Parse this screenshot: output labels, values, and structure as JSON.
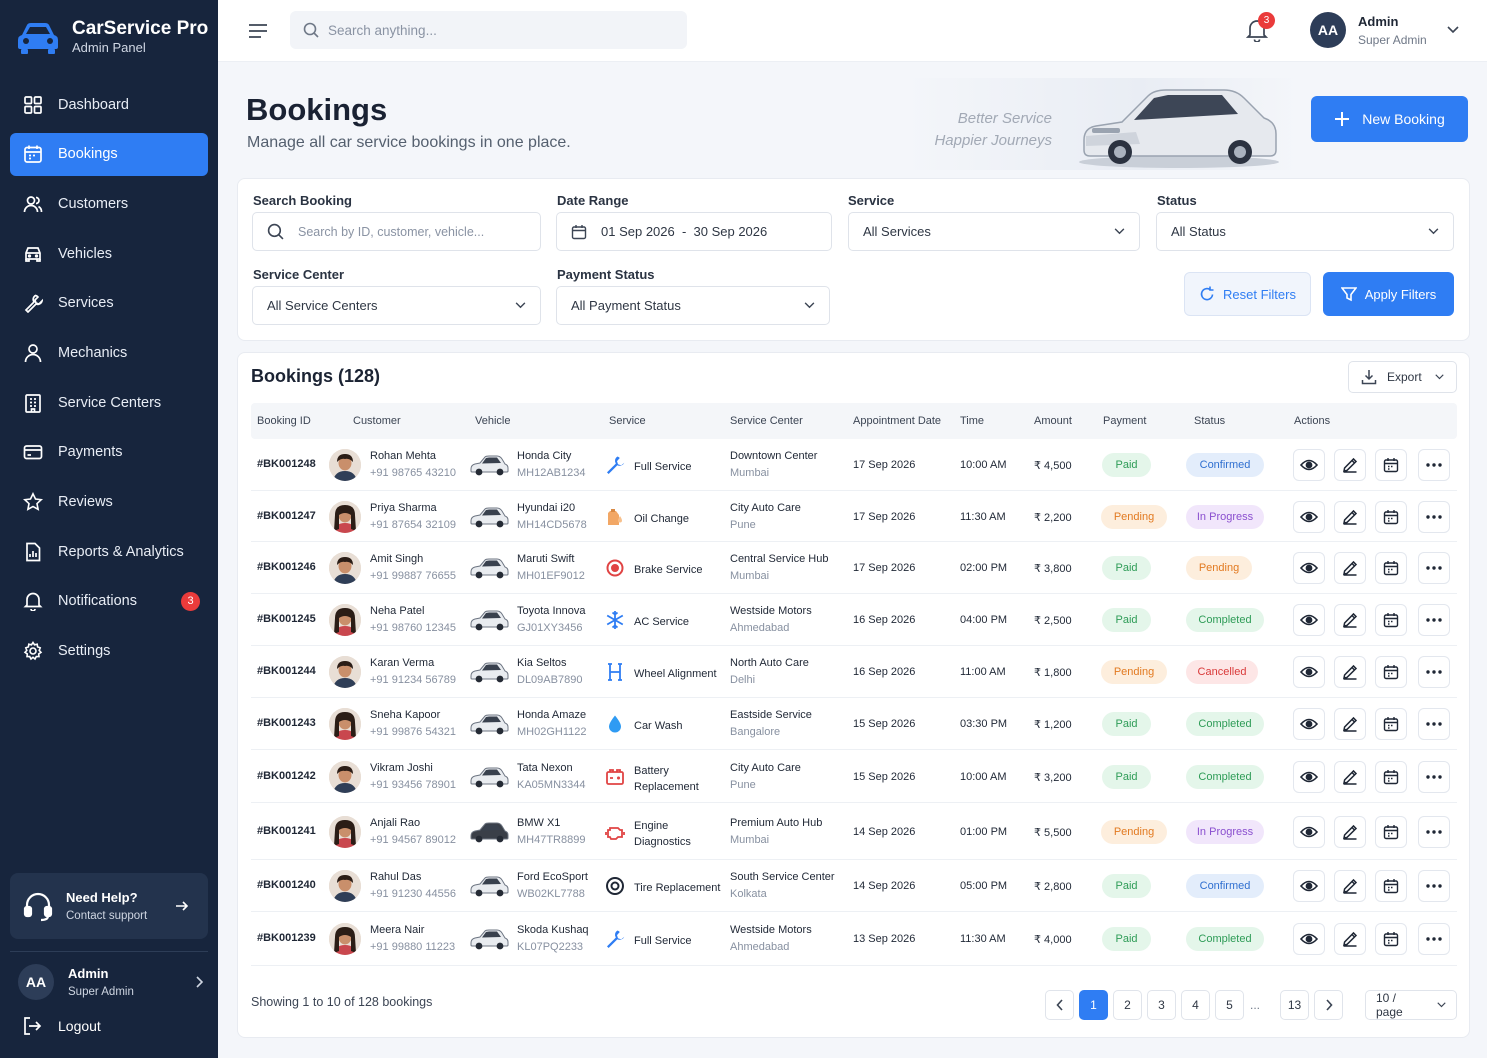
{
  "app": {
    "title": "CarService Pro",
    "subtitle": "Admin Panel"
  },
  "sidebar": {
    "items": [
      {
        "label": "Dashboard",
        "icon": "grid-icon"
      },
      {
        "label": "Bookings",
        "icon": "calendar-icon",
        "active": true
      },
      {
        "label": "Customers",
        "icon": "users-icon"
      },
      {
        "label": "Vehicles",
        "icon": "car-icon"
      },
      {
        "label": "Services",
        "icon": "wrench-icon"
      },
      {
        "label": "Mechanics",
        "icon": "user-icon"
      },
      {
        "label": "Service Centers",
        "icon": "building-icon"
      },
      {
        "label": "Payments",
        "icon": "card-icon"
      },
      {
        "label": "Reviews",
        "icon": "star-icon"
      },
      {
        "label": "Reports & Analytics",
        "icon": "report-icon"
      },
      {
        "label": "Notifications",
        "icon": "bell-icon",
        "badge": "3"
      },
      {
        "label": "Settings",
        "icon": "gear-icon"
      }
    ],
    "help": {
      "title": "Need Help?",
      "subtitle": "Contact support"
    },
    "user": {
      "initials": "AA",
      "name": "Admin",
      "role": "Super Admin"
    },
    "logout": "Logout"
  },
  "topbar": {
    "search_placeholder": "Search anything...",
    "notification_count": "3",
    "user": {
      "initials": "AA",
      "name": "Admin",
      "role": "Super Admin"
    }
  },
  "header": {
    "title": "Bookings",
    "subtitle": "Manage all car service bookings in one place.",
    "tagline_1": "Better Service",
    "tagline_2": "Happier Journeys",
    "new_booking": "New Booking"
  },
  "filters": {
    "search_label": "Search Booking",
    "search_placeholder": "Search by ID, customer, vehicle...",
    "date_label": "Date Range",
    "date_value": "01 Sep 2026  -  30 Sep 2026",
    "service_label": "Service",
    "service_value": "All Services",
    "status_label": "Status",
    "status_value": "All Status",
    "center_label": "Service Center",
    "center_value": "All Service Centers",
    "payment_label": "Payment Status",
    "payment_value": "All Payment Status",
    "reset": "Reset Filters",
    "apply": "Apply Filters"
  },
  "bookings": {
    "title": "Bookings (128)",
    "export": "Export",
    "columns": [
      "Booking ID",
      "Customer",
      "Vehicle",
      "Service",
      "Service Center",
      "Appointment Date",
      "Time",
      "Amount",
      "Payment",
      "Status",
      "Actions"
    ],
    "rows": [
      {
        "id": "#BK001248",
        "name": "Rohan Mehta",
        "phone": "+91 98765 43210",
        "gender": "m",
        "car": "Honda City",
        "plate": "MH12AB1234",
        "car_color": "#e9ecf0",
        "service": "Full Service",
        "svc_icon": "wrench-icon",
        "center": "Downtown Center",
        "city": "Mumbai",
        "date": "17 Sep 2026",
        "time": "10:00 AM",
        "amount": "₹ 4,500",
        "payment": "Paid",
        "status": "Confirmed"
      },
      {
        "id": "#BK001247",
        "name": "Priya Sharma",
        "phone": "+91 87654 32109",
        "gender": "f",
        "car": "Hyundai i20",
        "plate": "MH14CD5678",
        "car_color": "#e9ecf0",
        "service": "Oil Change",
        "svc_icon": "oil-icon",
        "center": "City Auto Care",
        "city": "Pune",
        "date": "17 Sep 2026",
        "time": "11:30 AM",
        "amount": "₹ 2,200",
        "payment": "Pending",
        "status": "In Progress"
      },
      {
        "id": "#BK001246",
        "name": "Amit Singh",
        "phone": "+91 99887 76655",
        "gender": "m",
        "car": "Maruti Swift",
        "plate": "MH01EF9012",
        "car_color": "#e9ecf0",
        "service": "Brake Service",
        "svc_icon": "brake-icon",
        "center": "Central Service Hub",
        "city": "Mumbai",
        "date": "17 Sep 2026",
        "time": "02:00 PM",
        "amount": "₹ 3,800",
        "payment": "Paid",
        "status": "Pending"
      },
      {
        "id": "#BK001245",
        "name": "Neha Patel",
        "phone": "+91 98760 12345",
        "gender": "f",
        "car": "Toyota Innova",
        "plate": "GJ01XY3456",
        "car_color": "#e9ecf0",
        "service": "AC Service",
        "svc_icon": "snowflake-icon",
        "center": "Westside Motors",
        "city": "Ahmedabad",
        "date": "16 Sep 2026",
        "time": "04:00 PM",
        "amount": "₹ 2,500",
        "payment": "Paid",
        "status": "Completed"
      },
      {
        "id": "#BK001244",
        "name": "Karan Verma",
        "phone": "+91 91234 56789",
        "gender": "m",
        "car": "Kia Seltos",
        "plate": "DL09AB7890",
        "car_color": "#e9ecf0",
        "service": "Wheel Alignment",
        "svc_icon": "alignment-icon",
        "center": "North Auto Care",
        "city": "Delhi",
        "date": "16 Sep 2026",
        "time": "11:00 AM",
        "amount": "₹ 1,800",
        "payment": "Pending",
        "status": "Cancelled"
      },
      {
        "id": "#BK001243",
        "name": "Sneha Kapoor",
        "phone": "+91 99876 54321",
        "gender": "f",
        "car": "Honda Amaze",
        "plate": "MH02GH1122",
        "car_color": "#e9ecf0",
        "service": "Car Wash",
        "svc_icon": "droplet-icon",
        "center": "Eastside Service",
        "city": "Bangalore",
        "date": "15 Sep 2026",
        "time": "03:30 PM",
        "amount": "₹ 1,200",
        "payment": "Paid",
        "status": "Completed"
      },
      {
        "id": "#BK001242",
        "name": "Vikram Joshi",
        "phone": "+91 93456 78901",
        "gender": "m",
        "car": "Tata Nexon",
        "plate": "KA05MN3344",
        "car_color": "#e9ecf0",
        "service": "Battery\nReplacement",
        "svc_icon": "battery-icon",
        "center": "City Auto Care",
        "city": "Pune",
        "date": "15 Sep 2026",
        "time": "10:00 AM",
        "amount": "₹ 3,200",
        "payment": "Paid",
        "status": "Completed"
      },
      {
        "id": "#BK001241",
        "name": "Anjali Rao",
        "phone": "+91 94567 89012",
        "gender": "f",
        "car": "BMW X1",
        "plate": "MH47TR8899",
        "car_color": "#3a3f48",
        "service": "Engine\nDiagnostics",
        "svc_icon": "engine-icon",
        "center": "Premium Auto Hub",
        "city": "Mumbai",
        "date": "14 Sep 2026",
        "time": "01:00 PM",
        "amount": "₹ 5,500",
        "payment": "Pending",
        "status": "In Progress"
      },
      {
        "id": "#BK001240",
        "name": "Rahul Das",
        "phone": "+91 91230 44556",
        "gender": "m",
        "car": "Ford EcoSport",
        "plate": "WB02KL7788",
        "car_color": "#e9ecf0",
        "service": "Tire Replacement",
        "svc_icon": "tire-icon",
        "center": "South Service Center",
        "city": "Kolkata",
        "date": "14 Sep 2026",
        "time": "05:00 PM",
        "amount": "₹ 2,800",
        "payment": "Paid",
        "status": "Confirmed"
      },
      {
        "id": "#BK001239",
        "name": "Meera Nair",
        "phone": "+91 99880 11223",
        "gender": "f",
        "car": "Skoda Kushaq",
        "plate": "KL07PQ2233",
        "car_color": "#e9ecf0",
        "service": "Full Service",
        "svc_icon": "wrench-icon",
        "center": "Westside Motors",
        "city": "Ahmedabad",
        "date": "13 Sep 2026",
        "time": "11:30 AM",
        "amount": "₹ 4,000",
        "payment": "Paid",
        "status": "Completed"
      }
    ]
  },
  "pagination": {
    "summary": "Showing 1 to 10 of 128 bookings",
    "pages": [
      "1",
      "2",
      "3",
      "4",
      "5",
      "...",
      "13"
    ],
    "current": "1",
    "page_size": "10 / page"
  },
  "colors": {
    "accent": "#2f7df3",
    "sidebar": "#17253d",
    "paid_bg": "#e4f6ea",
    "paid_fg": "#2e9c57",
    "pending_bg": "#fdeedd",
    "pending_fg": "#e27a21",
    "confirmed_bg": "#e3edfb",
    "confirmed_fg": "#2f6fd0",
    "progress_bg": "#f1e6fb",
    "progress_fg": "#8a4fcf",
    "cancelled_bg": "#fde6e6",
    "cancelled_fg": "#d93939"
  }
}
